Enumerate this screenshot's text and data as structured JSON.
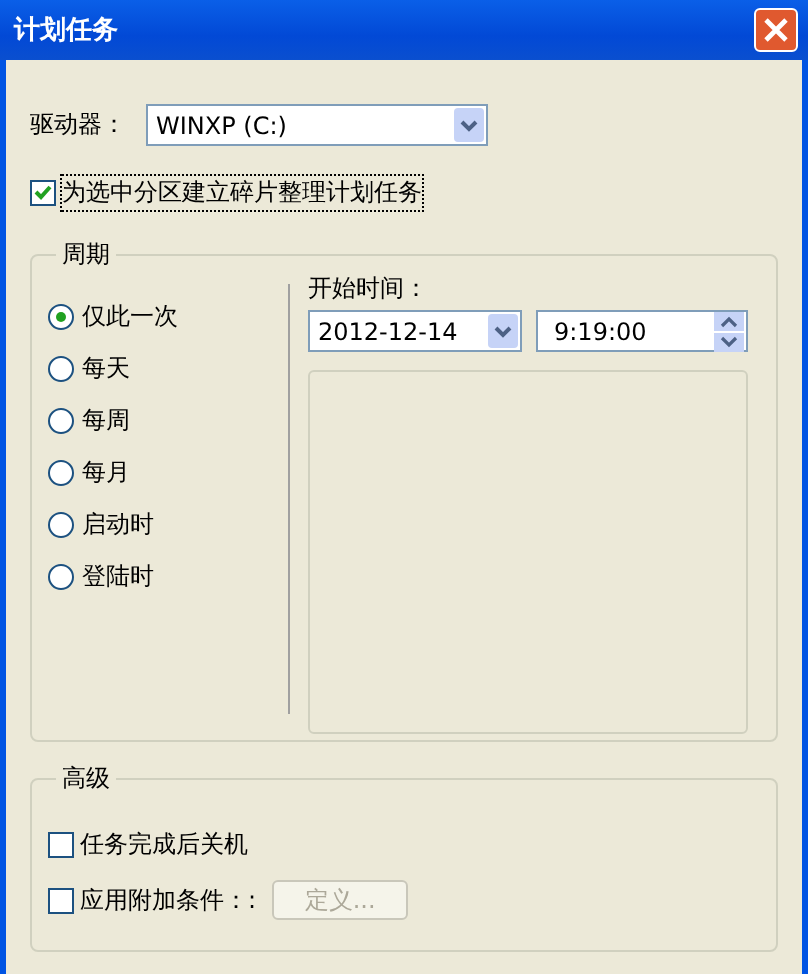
{
  "window": {
    "title": "计划任务"
  },
  "drive": {
    "label": "驱动器：",
    "value": "WINXP (C:)"
  },
  "schedule_checkbox": {
    "label": "为选中分区建立碎片整理计划任务",
    "checked": true
  },
  "period": {
    "title": "周期",
    "options": [
      {
        "label": "仅此一次",
        "selected": true
      },
      {
        "label": "每天",
        "selected": false
      },
      {
        "label": "每周",
        "selected": false
      },
      {
        "label": "每月",
        "selected": false
      },
      {
        "label": "启动时",
        "selected": false
      },
      {
        "label": "登陆时",
        "selected": false
      }
    ],
    "start_label": "开始时间：",
    "date": "2012-12-14",
    "time": "9:19:00"
  },
  "advanced": {
    "title": "高级",
    "options": [
      {
        "label": "任务完成后关机",
        "checked": false
      },
      {
        "label": "应用附加条件：:",
        "checked": false
      }
    ],
    "define_button": {
      "label": "定义...",
      "disabled": true
    }
  }
}
